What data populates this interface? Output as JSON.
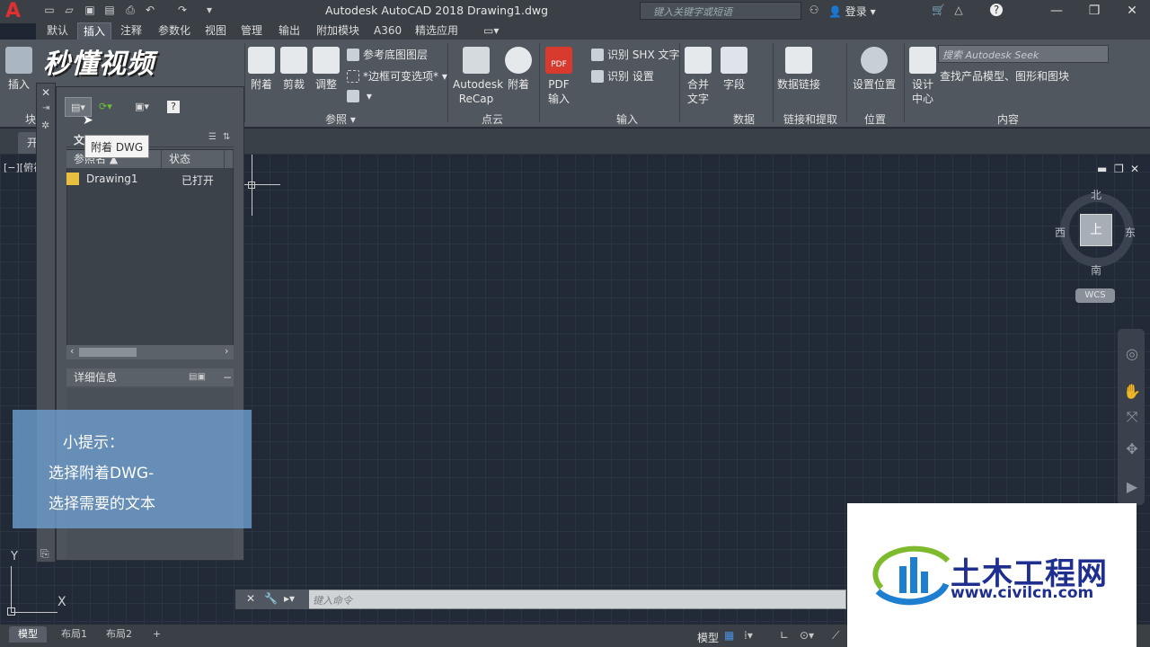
{
  "app": {
    "logo_letter": "A",
    "title": "Autodesk AutoCAD 2018    Drawing1.dwg",
    "search_placeholder": "键入关键字或短语",
    "signin": "登录",
    "workspace_icon": "workspace-switch"
  },
  "ribbon_tabs": [
    "默认",
    "插入",
    "注释",
    "参数化",
    "视图",
    "管理",
    "输出",
    "附加模块",
    "A360",
    "精选应用"
  ],
  "active_tab": "插入",
  "ribbon": {
    "block": {
      "insert": "插入",
      "panel": "块"
    },
    "reference": {
      "attach": "附着",
      "clip": "剪裁",
      "adjust": "调整",
      "underlay_layers": "参考底图图层",
      "frame_variable": "*边框可变选项*",
      "panel": "参照"
    },
    "pointcloud": {
      "recap_line1": "Autodesk",
      "recap_line2": "ReCap",
      "attach": "附着",
      "panel": "点云"
    },
    "import": {
      "pdf_line1": "PDF",
      "pdf_line2": "输入",
      "recognize_shx": "识别 SHX 文字",
      "recognize_settings": "识别 设置",
      "panel": "输入"
    },
    "data": {
      "combine_line1": "合并",
      "combine_line2": "文字",
      "field": "字段",
      "panel": "数据"
    },
    "linking": {
      "data_link": "数据链接",
      "panel": "链接和提取"
    },
    "location": {
      "set_location": "设置位置",
      "panel": "位置"
    },
    "content": {
      "design_center_line1": "设计",
      "design_center_line2": "中心",
      "seek_placeholder": "搜索 Autodesk Seek",
      "find_models": "查找产品模型、图形和图块",
      "panel": "内容"
    }
  },
  "brand_overlay": "秒懂视频",
  "file_tab_start": "开",
  "view_label": "[−][俯视",
  "palette": {
    "tooltip": "附着 DWG",
    "file_refs_header": "文",
    "columns": [
      "参照名",
      "状态"
    ],
    "rows": [
      {
        "name": "Drawing1",
        "status": "已打开"
      }
    ],
    "details": "详细信息"
  },
  "hint": {
    "title": "小提示：",
    "line1": "选择附着DWG-",
    "line2": "选择需要的文本"
  },
  "viewcube": {
    "face": "上",
    "north": "北",
    "south": "南",
    "east": "东",
    "west": "西",
    "wcs": "WCS"
  },
  "command": {
    "placeholder": "键入命令"
  },
  "ucs": {
    "x": "X",
    "y": "Y"
  },
  "layout_tabs": [
    "模型",
    "布局1",
    "布局2"
  ],
  "status_model": "模型",
  "watermark": {
    "name": "土木工程网",
    "url": "www.civilcn.com"
  }
}
